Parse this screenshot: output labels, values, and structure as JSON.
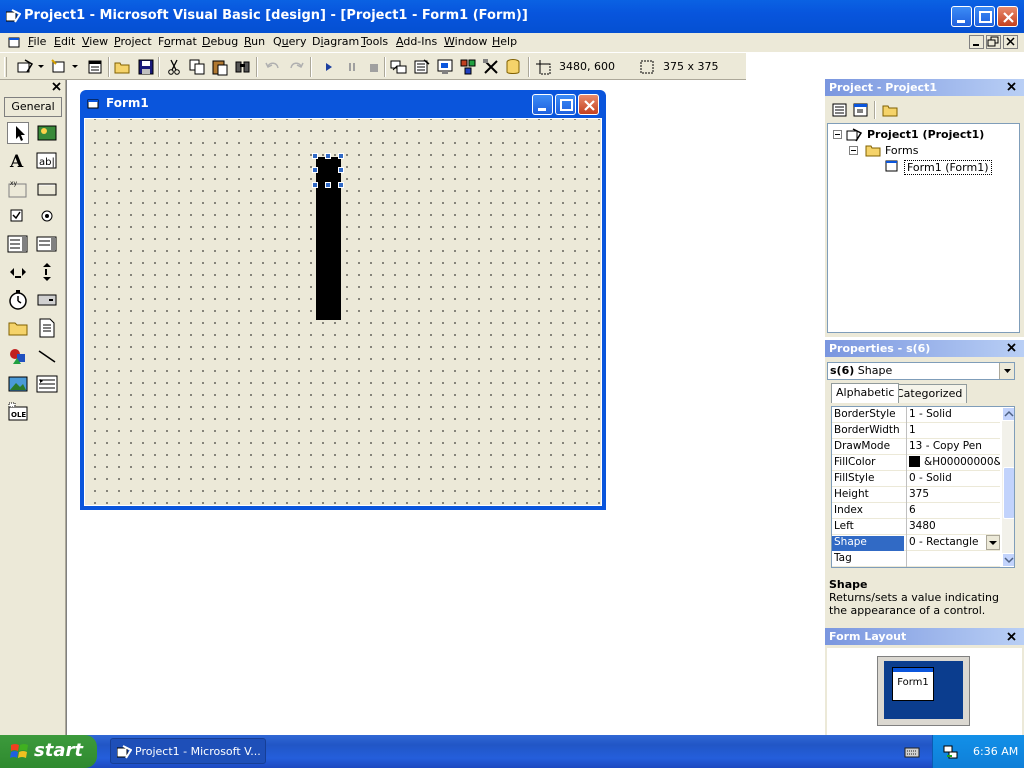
{
  "titlebar": {
    "title": "Project1 - Microsoft Visual Basic [design] - [Project1 - Form1 (Form)]"
  },
  "menus": [
    {
      "label": "File",
      "mn": "F"
    },
    {
      "label": "Edit",
      "mn": "E"
    },
    {
      "label": "View",
      "mn": "V"
    },
    {
      "label": "Project",
      "mn": "P"
    },
    {
      "label": "Format",
      "mn": "o"
    },
    {
      "label": "Debug",
      "mn": "D"
    },
    {
      "label": "Run",
      "mn": "R"
    },
    {
      "label": "Query",
      "mn": "u"
    },
    {
      "label": "Diagram",
      "mn": "i"
    },
    {
      "label": "Tools",
      "mn": "T"
    },
    {
      "label": "Add-Ins",
      "mn": "A"
    },
    {
      "label": "Window",
      "mn": "W"
    },
    {
      "label": "Help",
      "mn": "H"
    }
  ],
  "toolbar": {
    "position": "3480, 600",
    "size": "375 x 375"
  },
  "toolbox": {
    "tab": "General"
  },
  "form": {
    "title": "Form1"
  },
  "project": {
    "header": "Project - Project1",
    "root": "Project1 (Project1)",
    "folder": "Forms",
    "item": "Form1 (Form1)"
  },
  "properties": {
    "header": "Properties - s(6)",
    "object_name": "s(6)",
    "object_type": "Shape",
    "tabs": [
      "Alphabetic",
      "Categorized"
    ],
    "rows": [
      {
        "name": "BorderStyle",
        "value": "1 - Solid"
      },
      {
        "name": "BorderWidth",
        "value": "1"
      },
      {
        "name": "DrawMode",
        "value": "13 - Copy Pen"
      },
      {
        "name": "FillColor",
        "value": "&H00000000&"
      },
      {
        "name": "FillStyle",
        "value": "0 - Solid"
      },
      {
        "name": "Height",
        "value": "375"
      },
      {
        "name": "Index",
        "value": "6"
      },
      {
        "name": "Left",
        "value": "3480"
      },
      {
        "name": "Shape",
        "value": "0 - Rectangle"
      },
      {
        "name": "Tag",
        "value": ""
      }
    ],
    "selected_row": "Shape",
    "desc_title": "Shape",
    "desc_text": "Returns/sets a value indicating the appearance of a control."
  },
  "form_layout": {
    "header": "Form Layout",
    "mini_form": "Form1"
  },
  "taskbar": {
    "start": "start",
    "item": "Project1 - Microsoft V...",
    "clock": "6:36 AM"
  },
  "colors": {
    "titlebar": "#0a55dc",
    "selection": "#316ac5",
    "shape_fill": "#000000",
    "taskbar": "#245edb",
    "start": "#3c9a3c"
  }
}
